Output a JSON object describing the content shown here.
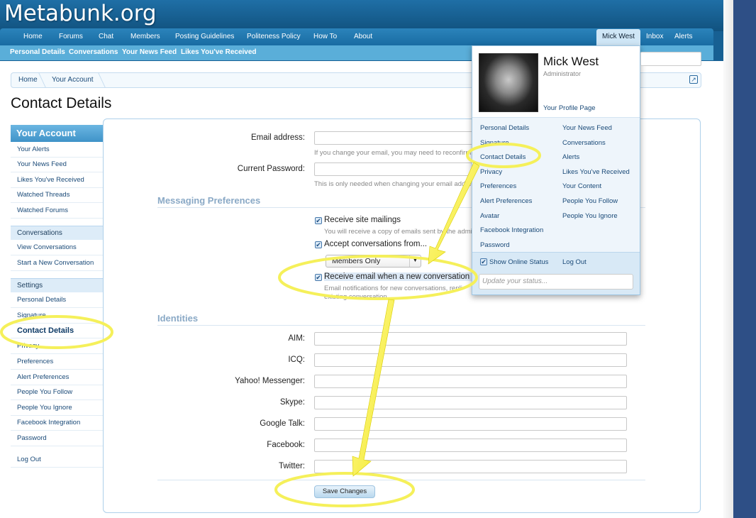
{
  "site": {
    "logo": "Metabunk.org"
  },
  "nav": {
    "items": [
      "Home",
      "Forums",
      "Chat",
      "Members",
      "Posting Guidelines",
      "Politeness Policy",
      "How To",
      "About"
    ],
    "user": "Mick West",
    "inbox": "Inbox",
    "alerts": "Alerts"
  },
  "subnav": [
    "Personal Details",
    "Conversations",
    "Your News Feed",
    "Likes You've Received"
  ],
  "breadcrumb": [
    "Home",
    "Your Account"
  ],
  "page_title": "Contact Details",
  "sidebar": {
    "heading": "Your Account",
    "group1": [
      "Your Alerts",
      "Your News Feed",
      "Likes You've Received",
      "Watched Threads",
      "Watched Forums"
    ],
    "conversations_head": "Conversations",
    "group2": [
      "View Conversations",
      "Start a New Conversation"
    ],
    "settings_head": "Settings",
    "group3": [
      "Personal Details",
      "Signature",
      "Contact Details",
      "Privacy",
      "Preferences",
      "Alert Preferences",
      "People You Follow",
      "People You Ignore",
      "Facebook Integration",
      "Password"
    ],
    "logout": "Log Out"
  },
  "form": {
    "email_label": "Email address:",
    "email_hint": "If you change your email, you may need to reconfirm",
    "password_label": "Current Password:",
    "password_hint": "This is only needed when changing your email address",
    "messaging_heading": "Messaging Preferences",
    "receive_mailings": "Receive site mailings",
    "mailings_hint": "You will receive a copy of emails sent by the admin",
    "accept_conversations": "Accept conversations from...",
    "conversations_select": "Members Only",
    "receive_email": "Receive email when a new conversation m",
    "email_hint2": "Email notifications for new conversations, repli",
    "email_hint3": "existing conversation",
    "identities_heading": "Identities",
    "identities": [
      "AIM:",
      "ICQ:",
      "Yahoo! Messenger:",
      "Skype:",
      "Google Talk:",
      "Facebook:",
      "Twitter:"
    ],
    "save": "Save Changes"
  },
  "popup": {
    "name": "Mick West",
    "role": "Administrator",
    "profile_link": "Your Profile Page",
    "left_links": [
      "Personal Details",
      "Signature",
      "Contact Details",
      "Privacy",
      "Preferences",
      "Alert Preferences",
      "Avatar",
      "Facebook Integration",
      "Password"
    ],
    "right_links": [
      "Your News Feed",
      "Conversations",
      "Alerts",
      "Likes You've Received",
      "Your Content",
      "People You Follow",
      "People You Ignore"
    ],
    "show_online": "Show Online Status",
    "logout": "Log Out",
    "status_placeholder": "Update your status..."
  },
  "colors": {
    "annotation": "#f5f05a",
    "header": "#176093",
    "accent": "#3f93c8"
  }
}
